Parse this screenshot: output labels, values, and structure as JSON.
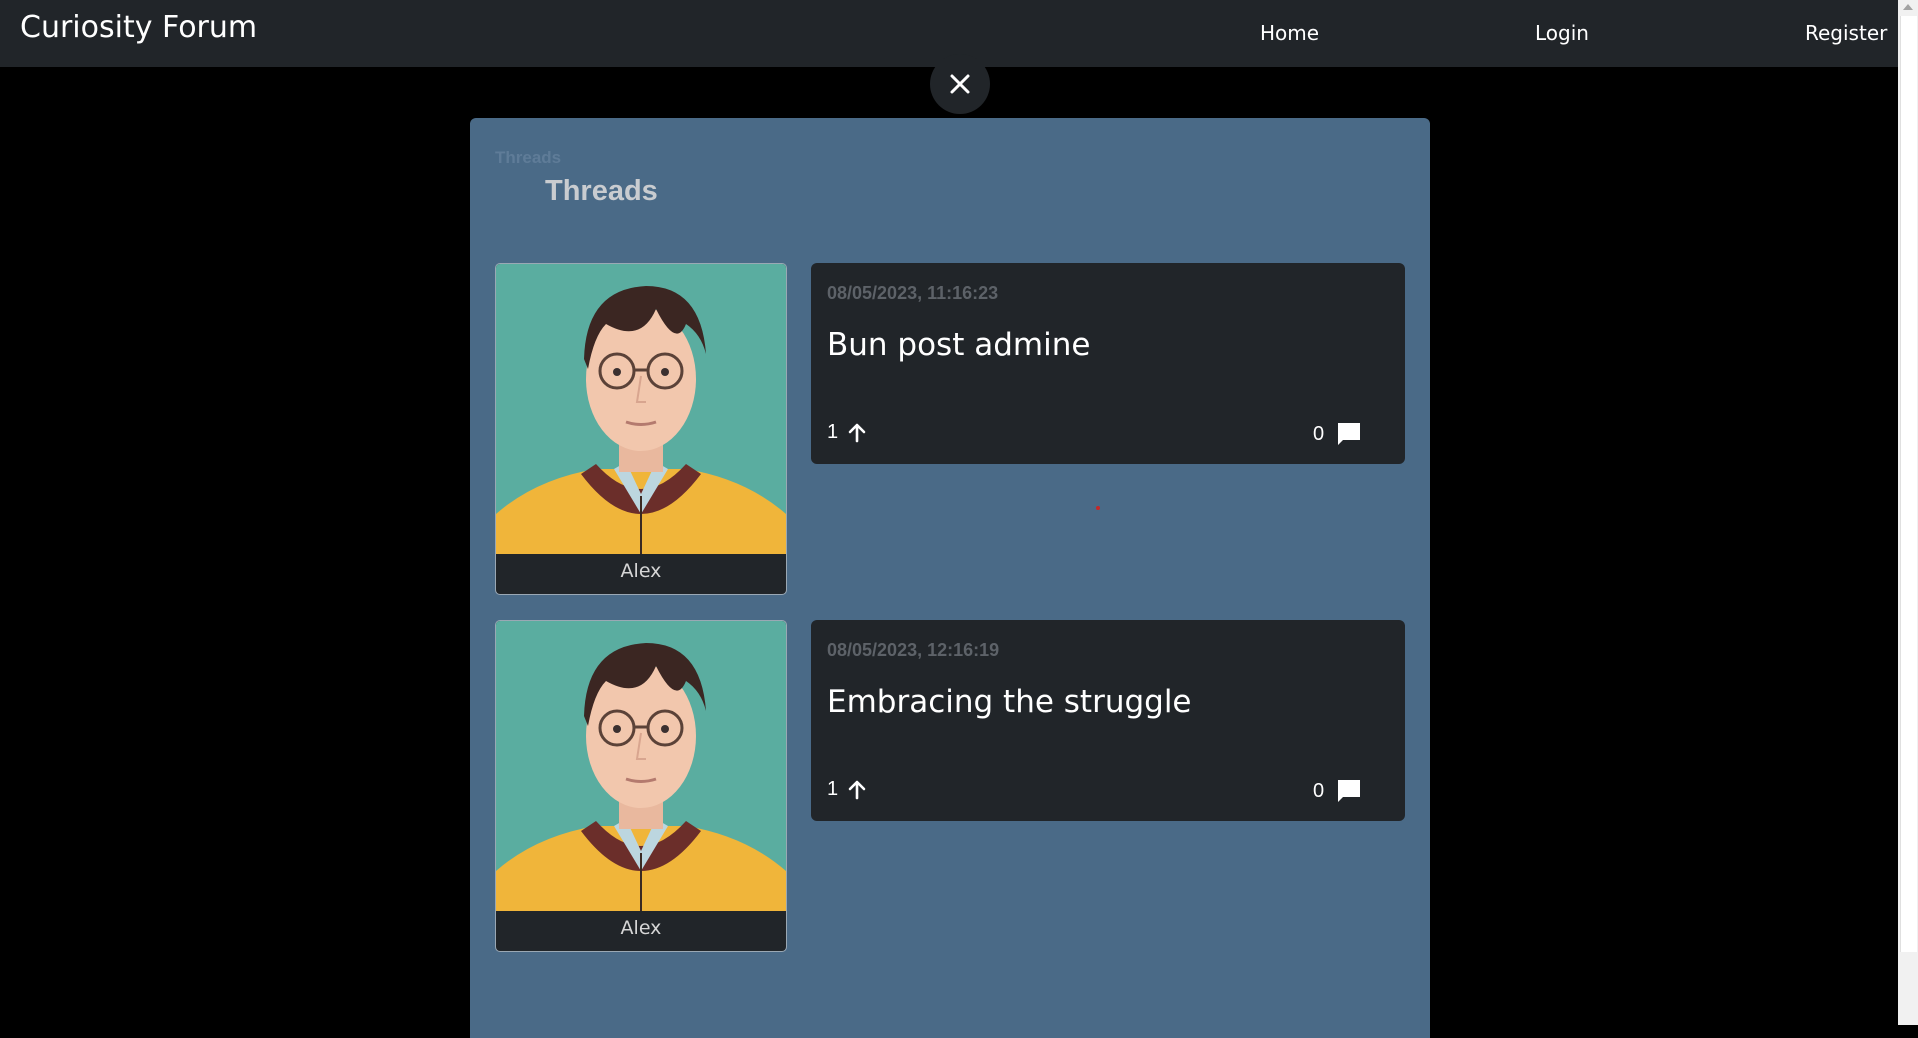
{
  "navbar": {
    "brand": "Curiosity Forum",
    "links": [
      "Home",
      "Login",
      "Register"
    ]
  },
  "close_icon": "close-icon",
  "panel": {
    "breadcrumb": "Threads",
    "title": "Threads"
  },
  "threads": [
    {
      "author": "Alex",
      "date": "08/05/2023, 11:16:23",
      "title": "Bun post admine",
      "upvotes": "1",
      "comments": "0"
    },
    {
      "author": "Alex",
      "date": "08/05/2023, 12:16:19",
      "title": "Embracing the struggle",
      "upvotes": "1",
      "comments": "0"
    }
  ],
  "colors": {
    "navbar": "#212529",
    "panel": "#4a6a87",
    "card": "#212529",
    "avatar_bg": "#5aada0"
  }
}
